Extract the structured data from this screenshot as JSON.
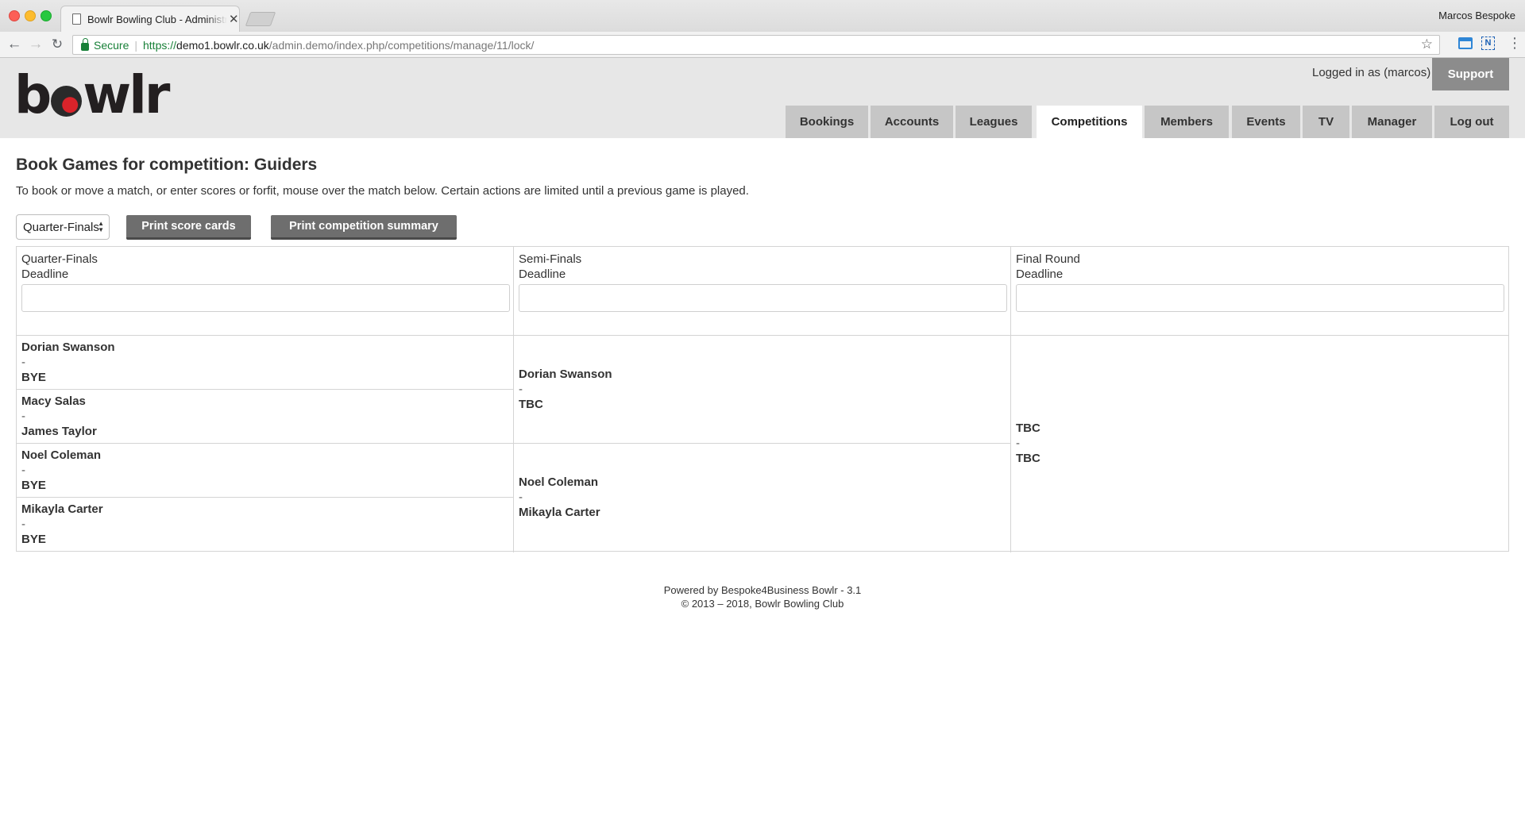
{
  "browser": {
    "tab_title": "Bowlr Bowling Club - Administration",
    "profile_name": "Marcos Bespoke",
    "secure_label": "Secure",
    "url_scheme": "https://",
    "url_host": "demo1.bowlr.co.uk",
    "url_path": "/admin.demo/index.php/competitions/manage/11/lock/"
  },
  "header": {
    "logo_left": "b",
    "logo_right": "wlr",
    "logged_in_text": "Logged in as (marcos)",
    "support_label": "Support"
  },
  "nav": {
    "bookings": "Bookings",
    "accounts": "Accounts",
    "leagues": "Leagues",
    "competitions": "Competitions",
    "members": "Members",
    "events": "Events",
    "tv": "TV",
    "manager": "Manager",
    "logout": "Log out",
    "active": "Competitions"
  },
  "page": {
    "title": "Book Games for competition: Guiders",
    "instructions": "To book or move a match, or enter scores or forfit, mouse over the match below. Certain actions are limited until a previous game is played.",
    "round_select_value": "Quarter-Finals",
    "print_score_cards": "Print score cards",
    "print_summary": "Print competition summary"
  },
  "bracket": {
    "deadline_label": "Deadline",
    "dash": "-",
    "rounds": [
      {
        "name": "Quarter-Finals",
        "deadline_value": "",
        "matches": [
          {
            "home": "Dorian Swanson",
            "away": "BYE"
          },
          {
            "home": "Macy Salas",
            "away": "James Taylor"
          },
          {
            "home": "Noel Coleman",
            "away": "BYE"
          },
          {
            "home": "Mikayla Carter",
            "away": "BYE"
          }
        ]
      },
      {
        "name": "Semi-Finals",
        "deadline_value": "",
        "matches": [
          {
            "home": "Dorian Swanson",
            "away": "TBC"
          },
          {
            "home": "Noel Coleman",
            "away": "Mikayla Carter"
          }
        ]
      },
      {
        "name": "Final Round",
        "deadline_value": "",
        "matches": [
          {
            "home": "TBC",
            "away": "TBC"
          }
        ]
      }
    ]
  },
  "footer": {
    "powered_by": "Powered by Bespoke4Business Bowlr - 3.1",
    "copyright": "© 2013 – 2018, Bowlr Bowling Club"
  }
}
